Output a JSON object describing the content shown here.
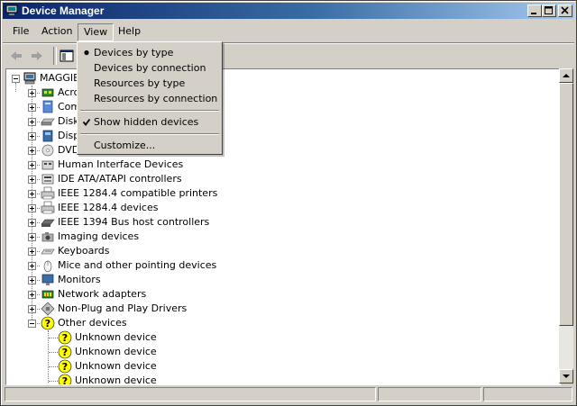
{
  "window": {
    "title": "Device Manager"
  },
  "menubar": {
    "file": "File",
    "action": "Action",
    "view": "View",
    "help": "Help"
  },
  "view_menu": {
    "devices_by_type": "Devices by type",
    "devices_by_connection": "Devices by connection",
    "resources_by_type": "Resources by type",
    "resources_by_connection": "Resources by connection",
    "show_hidden_devices": "Show hidden devices",
    "customize": "Customize...",
    "selected_view": "Devices by type",
    "show_hidden_checked": true
  },
  "tree": {
    "root": "MAGGIE",
    "categories": [
      {
        "label": "Acro",
        "icon": "chip-icon"
      },
      {
        "label": "Com",
        "icon": "computer-icon"
      },
      {
        "label": "Disk",
        "icon": "disk-drive-icon"
      },
      {
        "label": "Disp",
        "icon": "display-adapter-icon"
      },
      {
        "label": "DVD",
        "icon": "dvd-drive-icon"
      },
      {
        "label": "Human Interface Devices",
        "icon": "hid-icon"
      },
      {
        "label": "IDE ATA/ATAPI controllers",
        "icon": "ide-controller-icon"
      },
      {
        "label": "IEEE 1284.4 compatible printers",
        "icon": "printer-icon"
      },
      {
        "label": "IEEE 1284.4 devices",
        "icon": "printer-icon"
      },
      {
        "label": "IEEE 1394 Bus host controllers",
        "icon": "bus-controller-icon"
      },
      {
        "label": "Imaging devices",
        "icon": "camera-icon"
      },
      {
        "label": "Keyboards",
        "icon": "keyboard-icon"
      },
      {
        "label": "Mice and other pointing devices",
        "icon": "mouse-icon"
      },
      {
        "label": "Monitors",
        "icon": "monitor-icon"
      },
      {
        "label": "Network adapters",
        "icon": "network-adapter-icon"
      },
      {
        "label": "Non-Plug and Play Drivers",
        "icon": "driver-icon"
      },
      {
        "label": "Other devices",
        "icon": "unknown-device-icon"
      }
    ],
    "other_devices_children": [
      "Unknown device",
      "Unknown device",
      "Unknown device",
      "Unknown device"
    ]
  },
  "icons": {
    "back": "back-arrow-icon",
    "forward": "forward-arrow-icon",
    "show_hide_tree": "console-tree-icon",
    "app": "device-manager-icon",
    "minimize": "minimize-icon",
    "maximize": "maximize-icon",
    "close": "close-icon"
  },
  "colors": {
    "title_start": "#0a246a",
    "title_end": "#a6caf0",
    "window_bg": "#d4d0c8"
  }
}
